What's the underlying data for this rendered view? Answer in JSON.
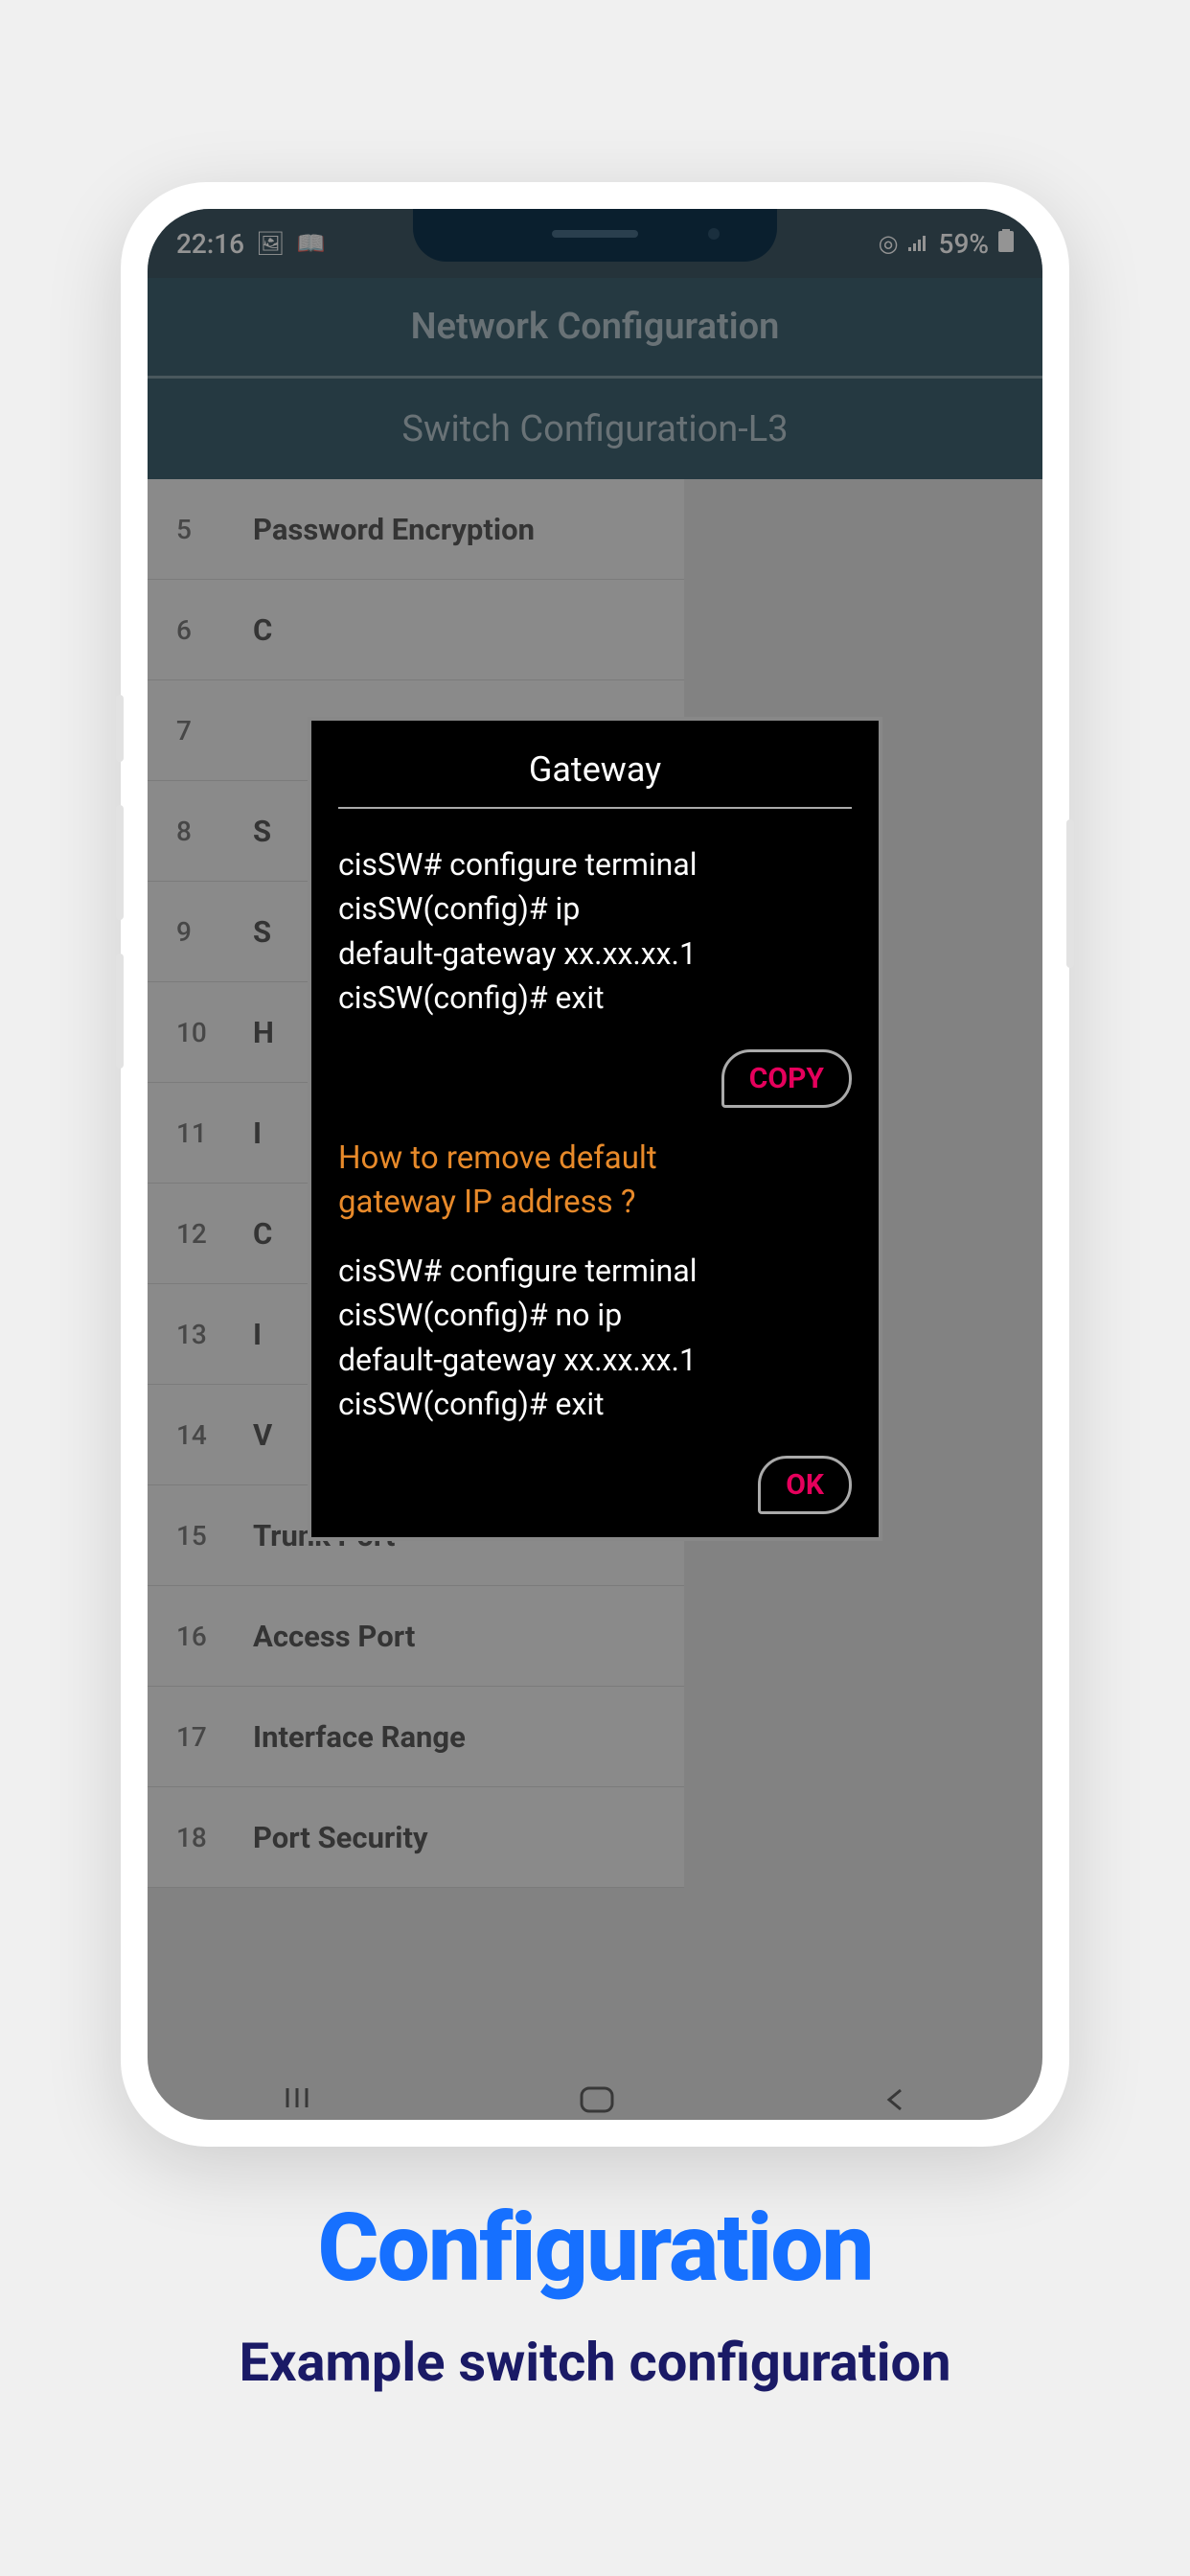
{
  "status": {
    "time": "22:16",
    "battery": "59%"
  },
  "header": {
    "title": "Network Configuration",
    "subtitle": "Switch Configuration-L3"
  },
  "list": [
    {
      "num": "5",
      "label": "Password Encryption"
    },
    {
      "num": "6",
      "label": "C"
    },
    {
      "num": "7",
      "label": ""
    },
    {
      "num": "8",
      "label": "S"
    },
    {
      "num": "9",
      "label": "S"
    },
    {
      "num": "10",
      "label": "H"
    },
    {
      "num": "11",
      "label": "I"
    },
    {
      "num": "12",
      "label": "C"
    },
    {
      "num": "13",
      "label": "I"
    },
    {
      "num": "14",
      "label": "V"
    },
    {
      "num": "15",
      "label": "Trunk Port"
    },
    {
      "num": "16",
      "label": "Access Port"
    },
    {
      "num": "17",
      "label": "Interface Range"
    },
    {
      "num": "18",
      "label": "Port Security"
    }
  ],
  "dialog": {
    "title": "Gateway",
    "code1_line1": "cisSW# configure terminal",
    "code1_line2": "cisSW(config)# ip",
    "code1_line3": "default-gateway xx.xx.xx.1",
    "code1_line4": "cisSW(config)# exit",
    "copy_label": "COPY",
    "question_line1": "How to remove default",
    "question_line2": "gateway IP address ?",
    "code2_line1": "cisSW# configure terminal",
    "code2_line2": "cisSW(config)# no ip",
    "code2_line3": "default-gateway xx.xx.xx.1",
    "code2_line4": "cisSW(config)# exit",
    "ok_label": "OK"
  },
  "promo": {
    "title": "Configuration",
    "subtitle": "Example switch configuration"
  }
}
